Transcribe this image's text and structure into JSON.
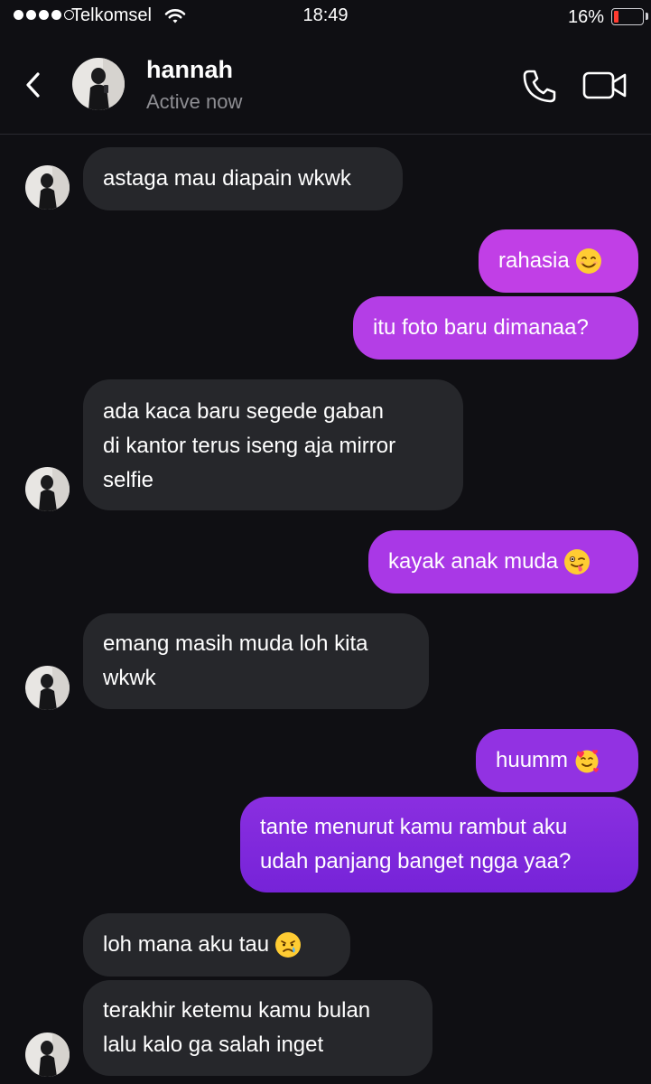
{
  "status_bar": {
    "carrier": "Telkomsel",
    "time": "18:49",
    "battery_percent": "16%",
    "battery_level": 0.16,
    "signal_bars": 4
  },
  "header": {
    "name": "hannah",
    "status": "Active now",
    "icons": [
      "back-chevron-icon",
      "phone-icon",
      "video-camera-icon"
    ]
  },
  "messages": [
    {
      "from": "hannah",
      "text": "astaga mau diapain wkwk"
    },
    {
      "from": "me",
      "text": "rahasia",
      "emoji": "smiling-face-emoji"
    },
    {
      "from": "me",
      "text": "itu foto baru dimanaa?"
    },
    {
      "from": "hannah",
      "text": "ada kaca baru segede gaban\ndi kantor terus iseng aja mirror\nselfie"
    },
    {
      "from": "me",
      "text": "kayak anak muda",
      "emoji": "winking-tongue-emoji"
    },
    {
      "from": "hannah",
      "text": "emang masih muda loh kita\nwkwk"
    },
    {
      "from": "me",
      "text": "huumm",
      "emoji": "smiling-face-with-hearts-emoji"
    },
    {
      "from": "me",
      "text": "tante menurut kamu rambut aku\nudah panjang banget ngga yaa?"
    },
    {
      "from": "hannah",
      "text": "loh mana aku tau",
      "emoji": "crying-face-emoji"
    },
    {
      "from": "hannah",
      "text": "terakhir ketemu kamu bulan\nlalu kalo ga salah inget"
    }
  ],
  "colors": {
    "background": "#0f0f13",
    "incoming_bubble": "#26272b",
    "outgoing_gradient_top": "#c23ee6",
    "outgoing_gradient_bottom": "#7a22d9"
  }
}
